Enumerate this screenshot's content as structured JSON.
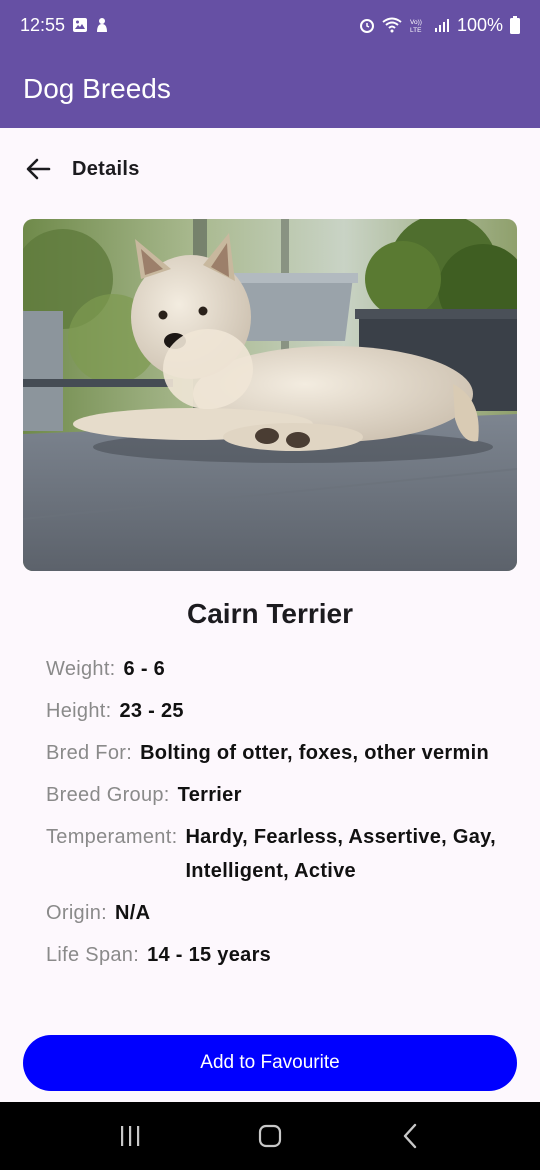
{
  "status_bar": {
    "time": "12:55",
    "battery": "100%",
    "left_icons": [
      "gallery-icon",
      "notification-icon"
    ],
    "right_icons": [
      "alarm-icon",
      "wifi-icon",
      "volte-icon",
      "signal-icon",
      "battery-icon"
    ],
    "volte_text": "VoLTE"
  },
  "app_bar": {
    "title": "Dog Breeds",
    "color": "#6650a4"
  },
  "details": {
    "header": "Details",
    "back_icon": "arrow-back-icon"
  },
  "dog": {
    "image_alt": "Cairn Terrier photo",
    "name": "Cairn Terrier",
    "fields": [
      {
        "label": "Weight:",
        "value": "6 - 6"
      },
      {
        "label": "Height:",
        "value": "23 - 25"
      },
      {
        "label": "Bred For:",
        "value": "Bolting of otter, foxes, other vermin"
      },
      {
        "label": "Breed Group:",
        "value": "Terrier"
      },
      {
        "label": "Temperament:",
        "value": "Hardy, Fearless, Assertive, Gay, Intelligent, Active"
      },
      {
        "label": "Origin:",
        "value": "N/A"
      },
      {
        "label": "Life Span:",
        "value": "14 - 15 years"
      }
    ]
  },
  "actions": {
    "favourite_label": "Add to Favourite",
    "favourite_color": "#0000ff"
  },
  "nav_bar": {
    "buttons": [
      "recent-apps-icon",
      "home-icon",
      "back-icon"
    ]
  }
}
